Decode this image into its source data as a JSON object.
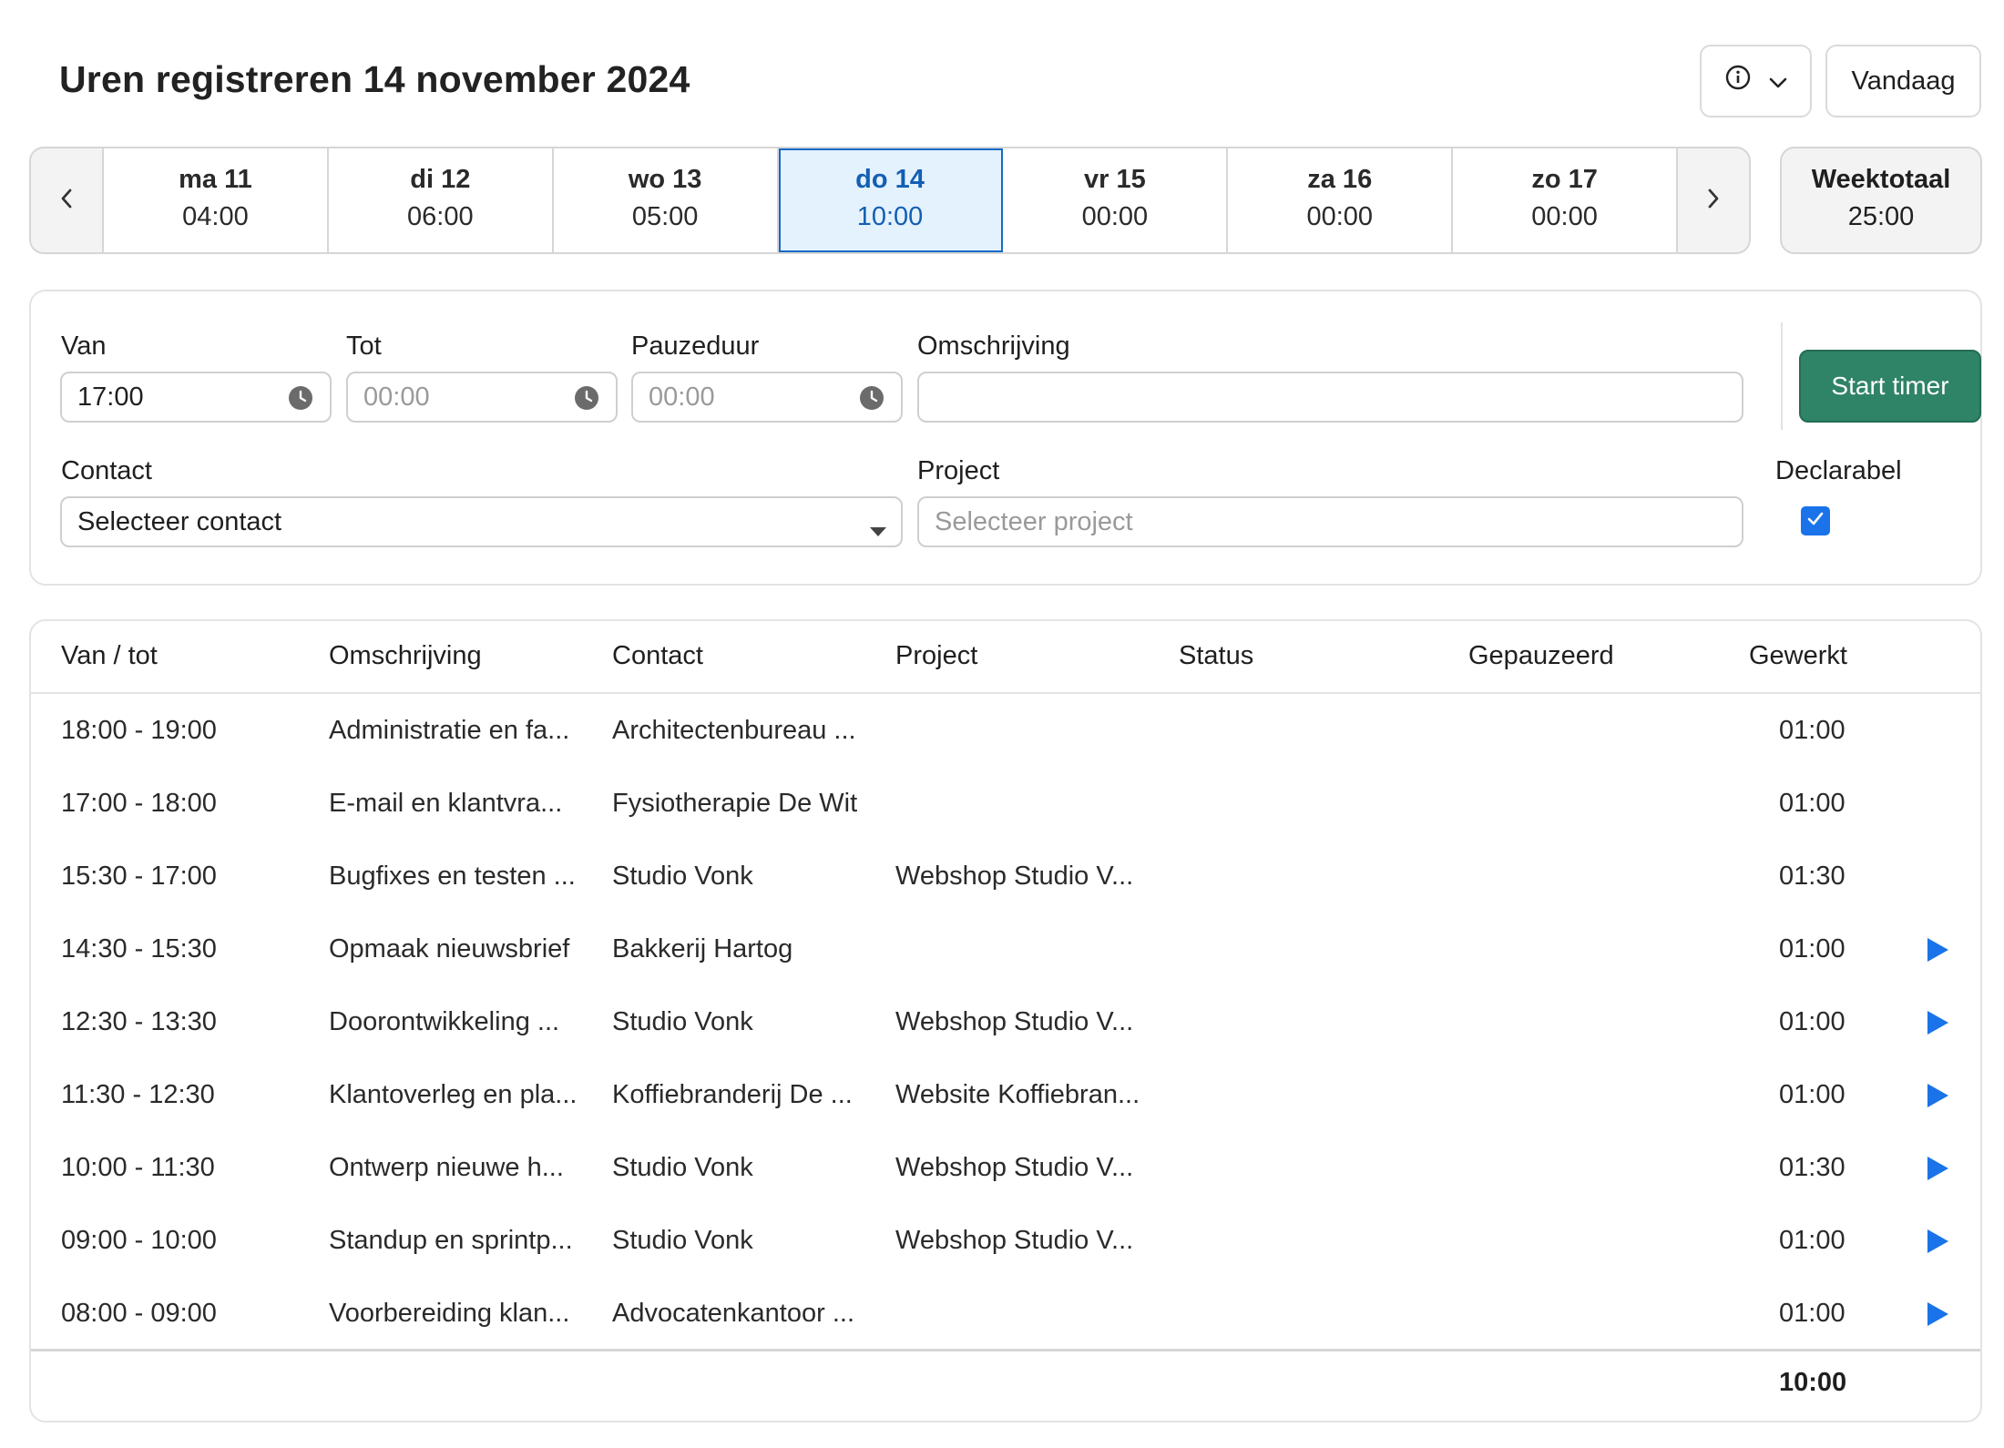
{
  "header": {
    "title": "Uren registreren 14 november 2024",
    "info_icon": "info-circle-icon",
    "today_label": "Vandaag"
  },
  "week": {
    "days": [
      {
        "name": "ma 11",
        "hours": "04:00",
        "active": false
      },
      {
        "name": "di 12",
        "hours": "06:00",
        "active": false
      },
      {
        "name": "wo 13",
        "hours": "05:00",
        "active": false
      },
      {
        "name": "do 14",
        "hours": "10:00",
        "active": true
      },
      {
        "name": "vr 15",
        "hours": "00:00",
        "active": false
      },
      {
        "name": "za 16",
        "hours": "00:00",
        "active": false
      },
      {
        "name": "zo 17",
        "hours": "00:00",
        "active": false
      }
    ],
    "total_label": "Weektotaal",
    "total_hours": "25:00"
  },
  "form": {
    "van_label": "Van",
    "van_value": "17:00",
    "tot_label": "Tot",
    "tot_placeholder": "00:00",
    "pauze_label": "Pauzeduur",
    "pauze_placeholder": "00:00",
    "omschrijving_label": "Omschrijving",
    "omschrijving_value": "",
    "contact_label": "Contact",
    "contact_value": "Selecteer contact",
    "project_label": "Project",
    "project_placeholder": "Selecteer project",
    "declarabel_label": "Declarabel",
    "declarabel_checked": true,
    "start_label": "Start timer"
  },
  "table": {
    "headers": {
      "vantot": "Van / tot",
      "omschrijving": "Omschrijving",
      "contact": "Contact",
      "project": "Project",
      "status": "Status",
      "gepauzeerd": "Gepauzeerd",
      "gewerkt": "Gewerkt"
    },
    "rows": [
      {
        "time": "18:00 - 19:00",
        "desc": "Administratie en fa...",
        "contact": "Architectenbureau ...",
        "project": "",
        "status": "",
        "paused": "",
        "worked": "01:00",
        "play": false
      },
      {
        "time": "17:00 - 18:00",
        "desc": "E-mail en klantvra...",
        "contact": "Fysiotherapie De Wit",
        "project": "",
        "status": "",
        "paused": "",
        "worked": "01:00",
        "play": false
      },
      {
        "time": "15:30 - 17:00",
        "desc": "Bugfixes en testen ...",
        "contact": "Studio Vonk",
        "project": "Webshop Studio V...",
        "status": "",
        "paused": "",
        "worked": "01:30",
        "play": false
      },
      {
        "time": "14:30 - 15:30",
        "desc": "Opmaak nieuwsbrief",
        "contact": "Bakkerij Hartog",
        "project": "",
        "status": "",
        "paused": "",
        "worked": "01:00",
        "play": true
      },
      {
        "time": "12:30 - 13:30",
        "desc": "Doorontwikkeling ...",
        "contact": "Studio Vonk",
        "project": "Webshop Studio V...",
        "status": "",
        "paused": "",
        "worked": "01:00",
        "play": true
      },
      {
        "time": "11:30 - 12:30",
        "desc": "Klantoverleg en pla...",
        "contact": "Koffiebranderij De ...",
        "project": "Website Koffiebran...",
        "status": "",
        "paused": "",
        "worked": "01:00",
        "play": true
      },
      {
        "time": "10:00 - 11:30",
        "desc": "Ontwerp nieuwe h...",
        "contact": "Studio Vonk",
        "project": "Webshop Studio V...",
        "status": "",
        "paused": "",
        "worked": "01:30",
        "play": true
      },
      {
        "time": "09:00 - 10:00",
        "desc": "Standup en sprintp...",
        "contact": "Studio Vonk",
        "project": "Webshop Studio V...",
        "status": "",
        "paused": "",
        "worked": "01:00",
        "play": true
      },
      {
        "time": "08:00 - 09:00",
        "desc": "Voorbereiding klan...",
        "contact": "Advocatenkantoor ...",
        "project": "",
        "status": "",
        "paused": "",
        "worked": "01:00",
        "play": true
      }
    ],
    "total_worked": "10:00"
  },
  "colors": {
    "accent_blue": "#1a73e8",
    "active_day_bg": "#e4f2fd",
    "active_day_text": "#135fb4",
    "start_button": "#2f8366"
  }
}
